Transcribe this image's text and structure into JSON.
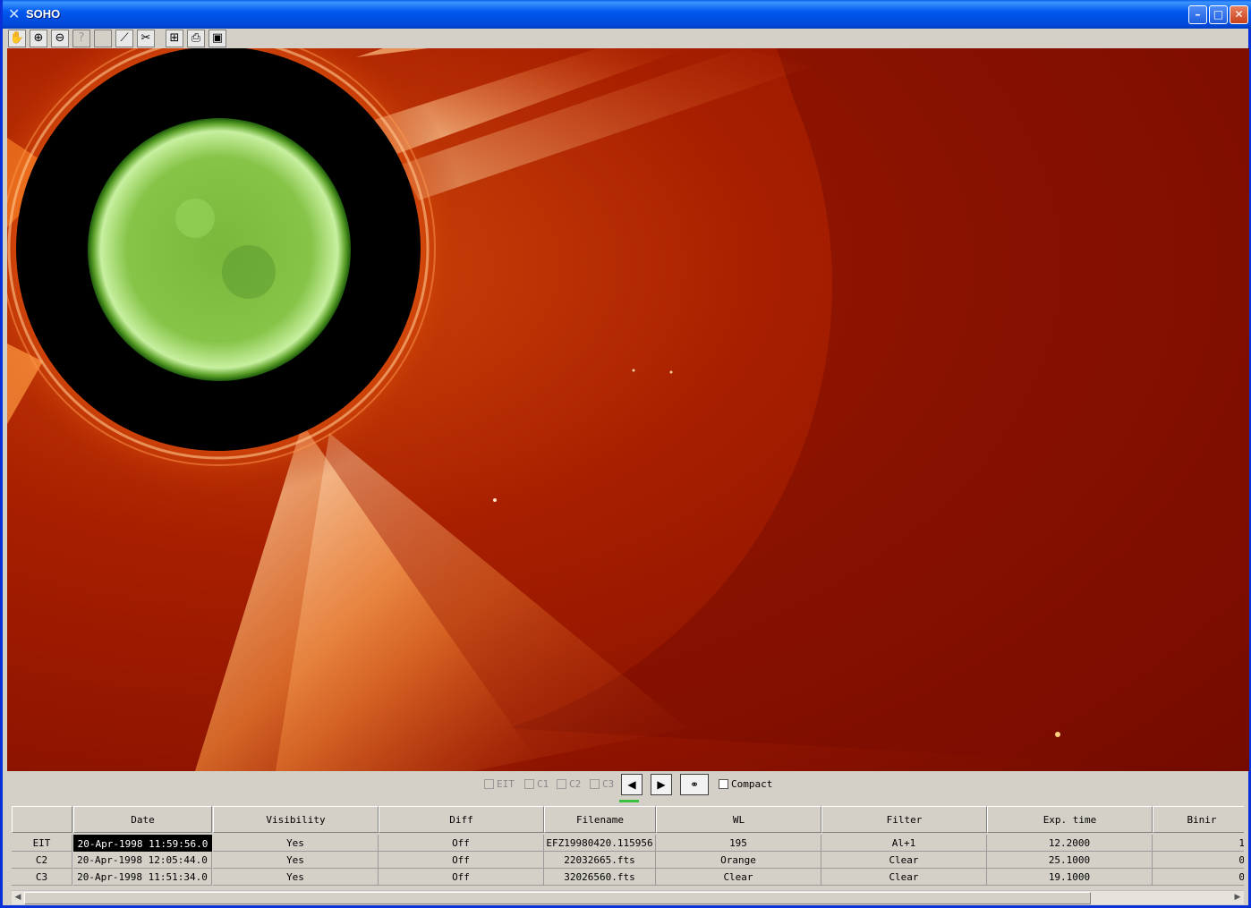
{
  "window": {
    "title": "SOHO",
    "icon": "soho-x-icon"
  },
  "title_buttons": [
    "minimize",
    "maximize",
    "close"
  ],
  "toolbar": {
    "tools": [
      {
        "name": "pan-hand-icon",
        "glyph": "✋",
        "enabled": true
      },
      {
        "name": "zoom-in-icon",
        "glyph": "⊕",
        "enabled": true
      },
      {
        "name": "zoom-out-icon",
        "glyph": "⊖",
        "enabled": true
      },
      {
        "name": "help-pointer-icon",
        "glyph": "?",
        "enabled": false
      },
      {
        "name": "blank-tool-icon",
        "glyph": "",
        "enabled": false
      },
      {
        "name": "plot-icon",
        "glyph": "⟋",
        "enabled": true
      },
      {
        "name": "cut-icon",
        "glyph": "✂",
        "enabled": true
      },
      {
        "name": "fit-view-icon",
        "glyph": "⊞",
        "enabled": true
      },
      {
        "name": "print-icon",
        "glyph": "⎙",
        "enabled": true
      },
      {
        "name": "save-icon",
        "glyph": "▣",
        "enabled": true
      }
    ]
  },
  "controls": {
    "layers": [
      {
        "label": "EIT",
        "checked": false
      },
      {
        "label": "C1",
        "checked": false
      },
      {
        "label": "C2",
        "checked": false
      },
      {
        "label": "C3",
        "checked": false
      }
    ],
    "prev_glyph": "◀",
    "next_glyph": "▶",
    "link_glyph": "⚭",
    "compact": {
      "label": "Compact",
      "checked": false
    }
  },
  "table": {
    "headers": [
      "",
      "Date",
      "Visibility",
      "Diff",
      "Filename",
      "WL",
      "Filter",
      "Exp. time",
      "Binir"
    ],
    "rows": [
      [
        "EIT",
        "20-Apr-1998 11:59:56.0",
        "Yes",
        "Off",
        "EFZ19980420.115956",
        "195",
        "Al+1",
        "12.2000",
        "1"
      ],
      [
        "C2",
        "20-Apr-1998 12:05:44.0",
        "Yes",
        "Off",
        "22032665.fts",
        "Orange",
        "Clear",
        "25.1000",
        "0"
      ],
      [
        "C3",
        "20-Apr-1998 11:51:34.0",
        "Yes",
        "Off",
        "32026560.fts",
        "Clear",
        "Clear",
        "19.1000",
        "0"
      ]
    ],
    "selected_cell": {
      "row": 0,
      "col": 1
    }
  },
  "colors": {
    "corona_dark": "#5e0800",
    "corona_mid": "#b32800",
    "corona_bright": "#ff8a2a",
    "sun_disk": "#7bd44a",
    "occulter": "#000000"
  }
}
